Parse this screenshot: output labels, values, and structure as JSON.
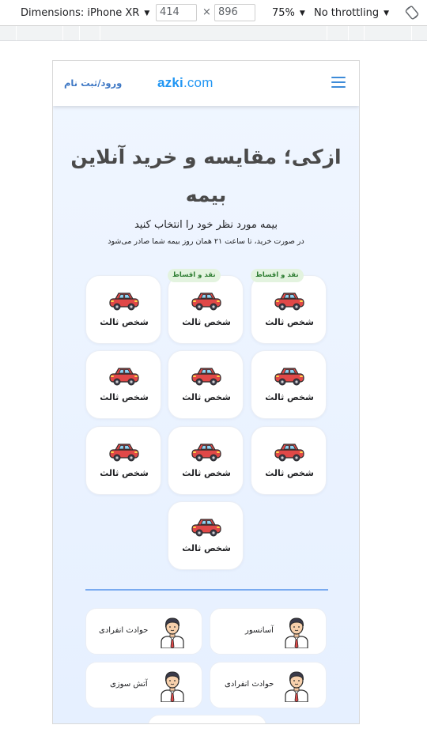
{
  "devtools": {
    "device": "Dimensions: iPhone XR",
    "width": "414",
    "times": "×",
    "height": "896",
    "zoom": "75%",
    "throttle": "No throttling"
  },
  "header": {
    "logo_main": "azki",
    "logo_suffix": ".com",
    "login": "ورود/ثبت نام"
  },
  "hero": {
    "title": "ازکی؛ مقایسه و خرید آنلاین بیمه",
    "subtitle": "بیمه مورد نظر خود را انتخاب کنید",
    "note": "در صورت خرید، تا ساعت ۲۱ همان روز بیمه شما صادر می‌شود"
  },
  "insurances": [
    {
      "label": "شخص ثالث",
      "badge": "نقد و اقساط"
    },
    {
      "label": "شخص ثالث",
      "badge": "نقد و اقساط"
    },
    {
      "label": "شخص ثالث",
      "badge": ""
    },
    {
      "label": "شخص ثالث",
      "badge": ""
    },
    {
      "label": "شخص ثالث",
      "badge": ""
    },
    {
      "label": "شخص ثالث",
      "badge": ""
    },
    {
      "label": "شخص ثالث",
      "badge": ""
    },
    {
      "label": "شخص ثالث",
      "badge": ""
    },
    {
      "label": "شخص ثالث",
      "badge": ""
    },
    {
      "label": "شخص ثالث",
      "badge": ""
    }
  ],
  "other_insurances": [
    {
      "label": "آسانسور"
    },
    {
      "label": "حوادث انفرادی"
    },
    {
      "label": "حوادث انفرادی"
    },
    {
      "label": "آتش سوزی"
    }
  ],
  "colors": {
    "accent": "#2196f3",
    "badge_bg": "#e3f3df",
    "badge_text": "#2e7d32",
    "divider": "#79aaf0"
  }
}
